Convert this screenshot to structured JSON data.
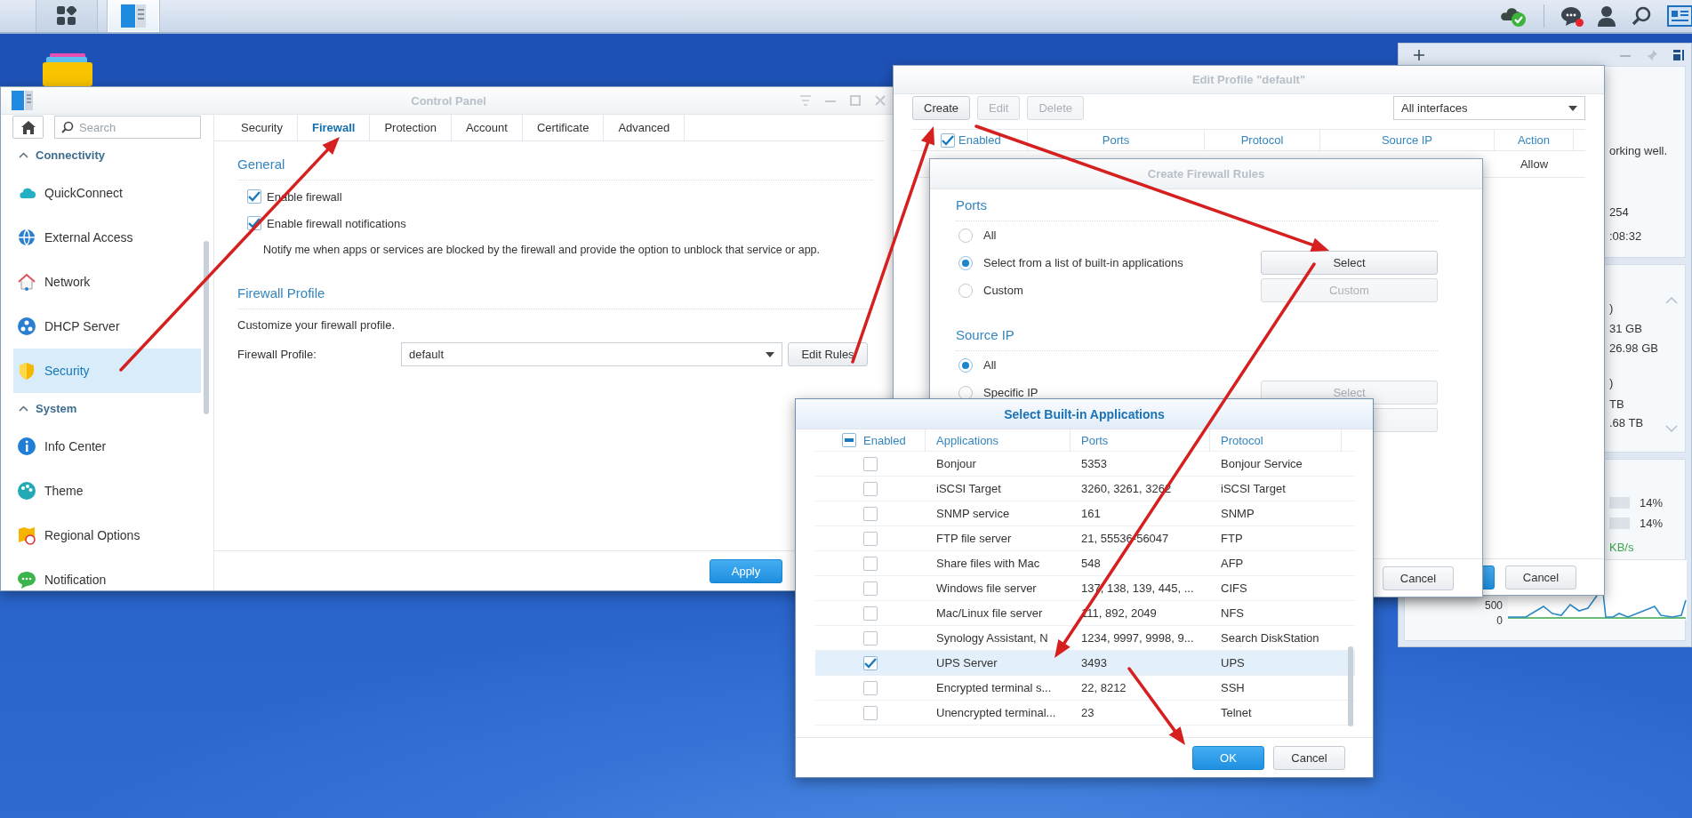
{
  "taskbar": {
    "items": [
      {
        "kind": "main_menu",
        "selected": false
      },
      {
        "kind": "control_panel",
        "selected": true
      }
    ],
    "notifications_unread": true
  },
  "control_panel": {
    "title": "Control Panel",
    "search": {
      "placeholder": "Search"
    },
    "sidebar": [
      {
        "kind": "group",
        "label": "Connectivity",
        "expanded": true
      },
      {
        "kind": "item",
        "label": "QuickConnect",
        "selected": false
      },
      {
        "kind": "item",
        "label": "External Access",
        "selected": false
      },
      {
        "kind": "item",
        "label": "Network",
        "selected": false
      },
      {
        "kind": "item",
        "label": "DHCP Server",
        "selected": false
      },
      {
        "kind": "item",
        "label": "Security",
        "selected": true
      },
      {
        "kind": "group",
        "label": "System",
        "expanded": true
      },
      {
        "kind": "item",
        "label": "Info Center",
        "selected": false
      },
      {
        "kind": "item",
        "label": "Theme",
        "selected": false
      },
      {
        "kind": "item",
        "label": "Regional Options",
        "selected": false
      },
      {
        "kind": "item",
        "label": "Notification",
        "selected": false
      }
    ],
    "tabs": [
      {
        "label": "Security",
        "selected": false
      },
      {
        "label": "Firewall",
        "selected": true
      },
      {
        "label": "Protection",
        "selected": false
      },
      {
        "label": "Account",
        "selected": false
      },
      {
        "label": "Certificate",
        "selected": false
      },
      {
        "label": "Advanced",
        "selected": false
      }
    ],
    "general": {
      "heading": "General",
      "options": [
        {
          "label": "Enable firewall",
          "checked": true
        },
        {
          "label": "Enable firewall notifications",
          "checked": true
        }
      ],
      "note": "Notify me when apps or services are blocked by the firewall and provide the option to unblock that service or app."
    },
    "profile": {
      "heading": "Firewall Profile",
      "description": "Customize your firewall profile.",
      "field_label": "Firewall Profile:",
      "value": "default",
      "button": "Edit Rules"
    },
    "apply_button": "Apply"
  },
  "edit_profile": {
    "title": "Edit Profile \"default\"",
    "buttons": [
      {
        "label": "Create",
        "disabled": false
      },
      {
        "label": "Edit",
        "disabled": true
      },
      {
        "label": "Delete",
        "disabled": true
      }
    ],
    "interface": "All interfaces",
    "header_checked": true,
    "columns": [
      "Enabled",
      "Ports",
      "Protocol",
      "Source IP",
      "Action"
    ],
    "rows": [
      {
        "action": "Allow"
      }
    ],
    "footer_buttons": [
      {
        "kind": "primary"
      },
      {
        "kind": "secondary",
        "label": "Cancel"
      }
    ]
  },
  "create_rules": {
    "title": "Create Firewall Rules",
    "sections": [
      {
        "heading": "Ports",
        "options": [
          {
            "label": "All",
            "selected": false
          },
          {
            "label": "Select from a list of built-in applications",
            "selected": true,
            "button": {
              "label": "Select",
              "disabled": false
            }
          },
          {
            "label": "Custom",
            "selected": false,
            "button": {
              "label": "Custom",
              "disabled": true
            }
          }
        ]
      },
      {
        "heading": "Source IP",
        "options": [
          {
            "label": "All",
            "selected": true
          },
          {
            "label": "Specific IP",
            "selected": false,
            "button": {
              "label": "Select",
              "disabled": true
            }
          }
        ],
        "extra_buttons": [
          {
            "disabled": true
          }
        ]
      }
    ],
    "footer_buttons": [
      {
        "kind": "secondary",
        "label": "Cancel"
      }
    ]
  },
  "select_apps": {
    "title": "Select Built-in Applications",
    "header_indeterminate": true,
    "columns": [
      "Enabled",
      "Applications",
      "Ports",
      "Protocol"
    ],
    "rows": [
      {
        "checked": false,
        "selected": false,
        "application": "Bonjour",
        "ports": "5353",
        "protocol": "Bonjour Service"
      },
      {
        "checked": false,
        "selected": false,
        "application": "iSCSI Target",
        "ports": "3260, 3261, 3262",
        "protocol": "iSCSI Target"
      },
      {
        "checked": false,
        "selected": false,
        "application": "SNMP service",
        "ports": "161",
        "protocol": "SNMP"
      },
      {
        "checked": false,
        "selected": false,
        "application": "FTP file server",
        "ports": "21, 55536-56047",
        "protocol": "FTP"
      },
      {
        "checked": false,
        "selected": false,
        "application": "Share files with Mac",
        "ports": "548",
        "protocol": "AFP"
      },
      {
        "checked": false,
        "selected": false,
        "application": "Windows file server",
        "ports": "137, 138, 139, 445, ...",
        "protocol": "CIFS"
      },
      {
        "checked": false,
        "selected": false,
        "application": "Mac/Linux file server",
        "ports": "111, 892, 2049",
        "protocol": "NFS"
      },
      {
        "checked": false,
        "selected": false,
        "application": "Synology Assistant, N",
        "ports": "1234, 9997, 9998, 9...",
        "protocol": "Search DiskStation"
      },
      {
        "checked": true,
        "selected": true,
        "application": "UPS Server",
        "ports": "3493",
        "protocol": "UPS"
      },
      {
        "checked": false,
        "selected": false,
        "application": "Encrypted terminal s...",
        "ports": "22, 8212",
        "protocol": "SSH"
      },
      {
        "checked": false,
        "selected": false,
        "application": "Unencrypted terminal...",
        "ports": "23",
        "protocol": "Telnet"
      }
    ],
    "buttons": [
      {
        "kind": "primary",
        "label": "OK"
      },
      {
        "kind": "secondary",
        "label": "Cancel"
      }
    ]
  },
  "widgets": {
    "panels": [
      {
        "lines": [
          "orking well.",
          "254",
          ":08:32"
        ]
      },
      {
        "lines": [
          ")",
          "31 GB",
          "26.98 GB",
          ")",
          "TB",
          ".68 TB"
        ]
      }
    ],
    "usage": {
      "meters": [
        {
          "reading": "14%"
        },
        {
          "reading": "14%"
        }
      ],
      "rate": "KB/s",
      "chart_ticks": [
        "500",
        "0"
      ]
    }
  }
}
